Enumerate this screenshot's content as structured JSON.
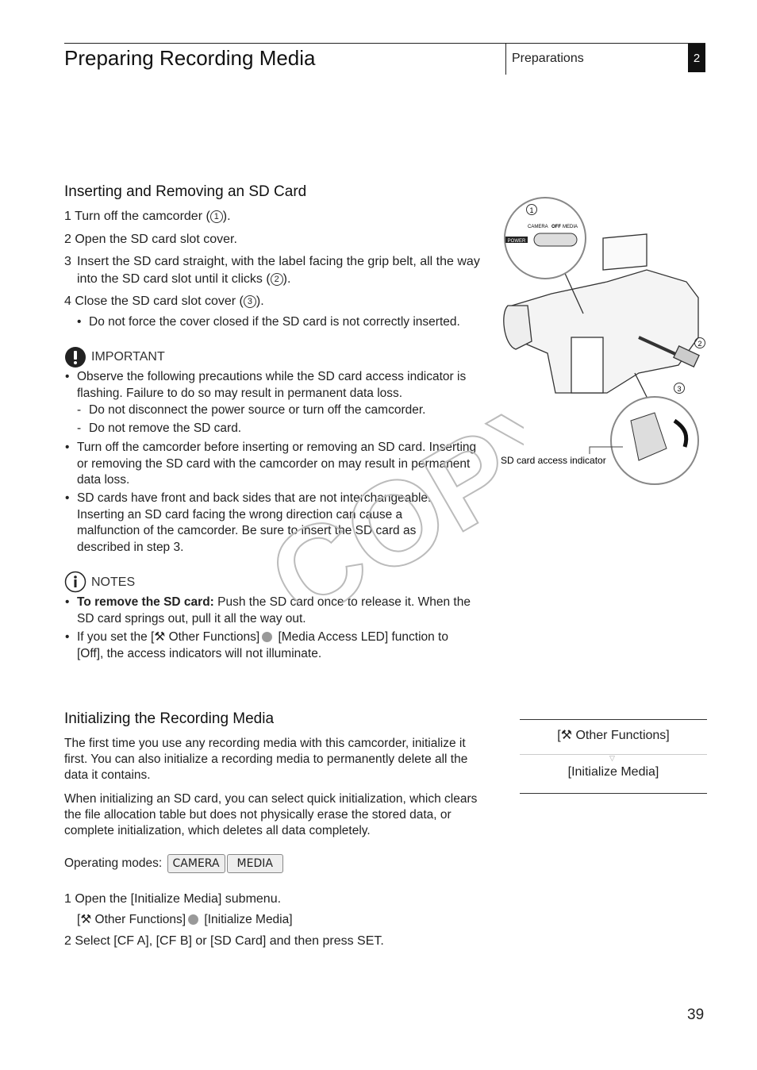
{
  "header": {
    "title": "Preparing Recording Media",
    "section": "Preparations",
    "chapter": "2"
  },
  "sd": {
    "heading": "Inserting and Removing an SD Card",
    "steps": [
      {
        "n": "1",
        "pre": "Turn off the camcorder (",
        "mark": "1",
        "post": ")."
      },
      {
        "n": "2",
        "text": "Open the SD card slot cover."
      },
      {
        "n": "3",
        "pre": "Insert the SD card straight, with the label facing the grip belt, all the way into the SD card slot until it clicks (",
        "mark": "2",
        "post": ")."
      },
      {
        "n": "4",
        "pre": "Close the SD card slot cover (",
        "mark": "3",
        "post": ")."
      }
    ],
    "step4_note": "Do not force the cover closed if the SD card is not correctly inserted.",
    "important_label": "IMPORTANT",
    "important": [
      "Observe the following precautions while the SD card access indicator is flashing. Failure to do so may result in permanent data loss.",
      "Turn off the camcorder before inserting or removing an SD card. Inserting or removing the SD card with the camcorder on may result in permanent data loss.",
      "SD cards have front and back sides that are not interchangeable. Inserting an SD card facing the wrong direction can cause a malfunction of the camcorder. Be sure to insert the SD card as described in step 3."
    ],
    "important_sub": [
      "Do not disconnect the power source or turn off the camcorder.",
      "Do not remove the SD card."
    ],
    "notes_label": "NOTES",
    "note1_bold": "To remove the SD card:",
    "note1_rest": " Push the SD card once to release it. When the SD card springs out, pull it all the way out.",
    "note2_a": "If you set the [",
    "note2_b": " Other Functions]",
    "note2_c": " [Media Access LED] function to [Off], the access indicators will not illuminate."
  },
  "figure": {
    "callouts": [
      "1",
      "2",
      "3"
    ],
    "switch_labels": [
      "CAMERA",
      "OFF",
      "MEDIA"
    ],
    "power": "POWER",
    "indicator_label": "SD card access indicator"
  },
  "init": {
    "heading": "Initializing the Recording Media",
    "para1": "The first time you use any recording media with this camcorder, initialize it first. You can also initialize a recording media to permanently delete all the data it contains.",
    "para2": "When initializing an SD card, you can select quick initialization, which clears the file allocation table but does not physically erase the stored data, or complete initialization, which deletes all data completely.",
    "modes_label": "Operating modes:",
    "modes": [
      "CAMERA",
      "MEDIA"
    ],
    "step1": "1 Open the [Initialize Media] submenu.",
    "step1_path_a": "[",
    "step1_path_b": " Other Functions]",
    "step1_path_c": " [Initialize Media]",
    "step2": "2 Select [CF A], [CF B] or [SD Card] and then press SET."
  },
  "menu": {
    "item1_a": "[",
    "item1_b": " Other Functions]",
    "item2": "[Initialize Media]"
  },
  "watermark": "COPY",
  "page_number": "39"
}
